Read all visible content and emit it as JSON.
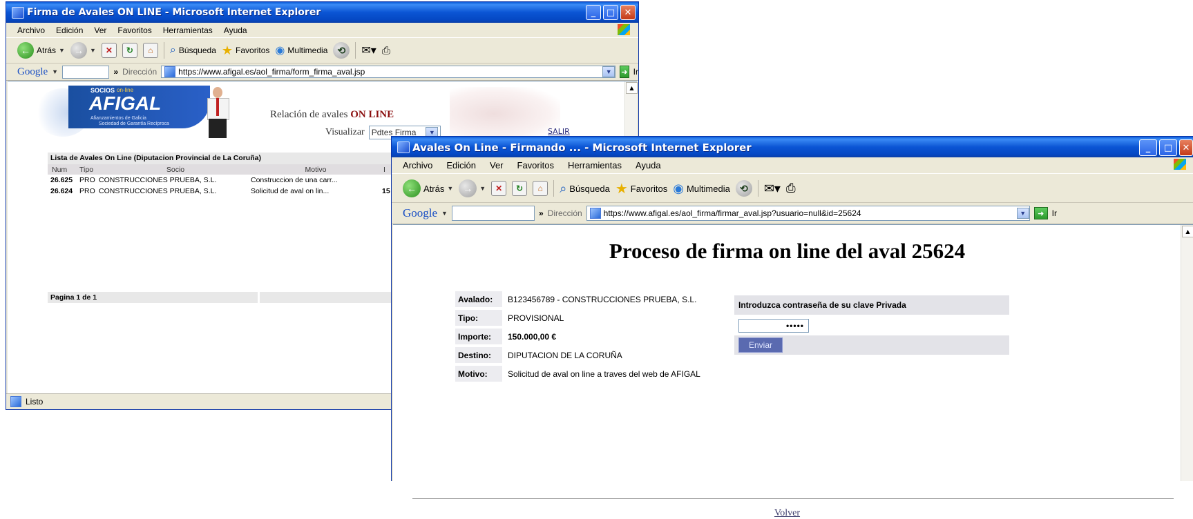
{
  "win1": {
    "title": "Firma de Avales ON LINE - Microsoft Internet Explorer",
    "menu": [
      "Archivo",
      "Edición",
      "Ver",
      "Favoritos",
      "Herramientas",
      "Ayuda"
    ],
    "toolbar": {
      "back": "Atrás",
      "search": "Búsqueda",
      "favorites": "Favoritos",
      "multimedia": "Multimedia"
    },
    "google_label": "Google",
    "address_label": "Dirección",
    "url": "https://www.afigal.es/aol_firma/form_firma_aval.jsp",
    "go_label": "Ir",
    "page": {
      "logo_top": "SOCIOS",
      "logo_online": "on-line",
      "logo_name": "AFIGAL",
      "logo_sub1": "Afianzamientos de Galicia",
      "logo_sub2": "Sociedad de Garantía Recíproca",
      "relacion_text": "Relación de avales",
      "relacion_bold": "ON LINE",
      "visualizar_label": "Visualizar",
      "visualizar_value": "Pdtes Firma",
      "salir": "SALIR",
      "table_title": "Lista de Avales On Line   (Diputacion Provincial de La Coruña)",
      "columns": [
        "Num",
        "Tipo",
        "Socio",
        "Motivo",
        "I"
      ],
      "rows": [
        {
          "num": "26.625",
          "tipo": "PRO",
          "socio": "CONSTRUCCIONES PRUEBA, S.L.",
          "motivo": "Construccion de una carr...",
          "importe": ""
        },
        {
          "num": "26.624",
          "tipo": "PRO",
          "socio": "CONSTRUCCIONES PRUEBA, S.L.",
          "motivo": "Solicitud de aval on lin...",
          "importe": "15"
        }
      ],
      "pagination": "Pagina 1 de 1"
    },
    "status": "Listo"
  },
  "win2": {
    "title": "Avales On Line - Firmando ... - Microsoft Internet Explorer",
    "menu": [
      "Archivo",
      "Edición",
      "Ver",
      "Favoritos",
      "Herramientas",
      "Ayuda"
    ],
    "toolbar": {
      "back": "Atrás",
      "search": "Búsqueda",
      "favorites": "Favoritos",
      "multimedia": "Multimedia"
    },
    "google_label": "Google",
    "address_label": "Dirección",
    "url": "https://www.afigal.es/aol_firma/firmar_aval.jsp?usuario=null&id=25624",
    "go_label": "Ir",
    "page": {
      "heading": "Proceso de firma on line del aval 25624",
      "details": [
        {
          "label": "Avalado:",
          "value": "B123456789 - CONSTRUCCIONES PRUEBA, S.L."
        },
        {
          "label": "Tipo:",
          "value": "PROVISIONAL"
        },
        {
          "label": "Importe:",
          "value": "150.000,00 €"
        },
        {
          "label": "Destino:",
          "value": "DIPUTACION DE LA CORUÑA"
        },
        {
          "label": "Motivo:",
          "value": "Solicitud de aval on line a traves del web de AFIGAL"
        }
      ],
      "password_prompt": "Introduzca contraseña de su clave Privada",
      "password_mask": "•••••",
      "submit": "Enviar",
      "back_link": "Volver"
    }
  }
}
